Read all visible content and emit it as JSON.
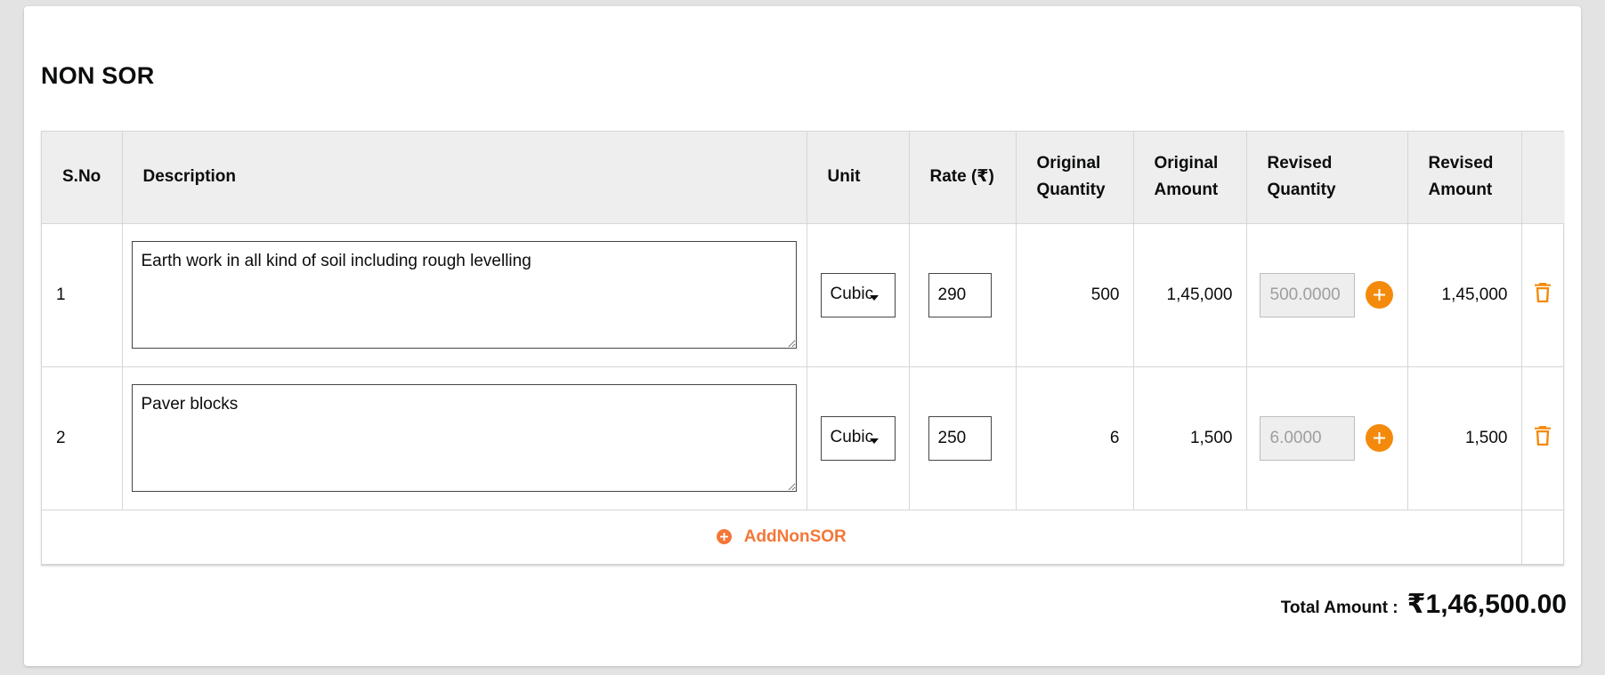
{
  "page": {
    "title": "NON SOR"
  },
  "table": {
    "headers": {
      "sno": "S.No",
      "description": "Description",
      "unit": "Unit",
      "rate": "Rate (₹)",
      "original_quantity_1": "Original",
      "original_quantity_2": "Quantity",
      "original_amount_1": "Original",
      "original_amount_2": "Amount",
      "revised_quantity_1": "Revised",
      "revised_quantity_2": "Quantity",
      "revised_amount_1": "Revised",
      "revised_amount_2": "Amount"
    },
    "rows": [
      {
        "sno": "1",
        "description": "Earth work in all kind of soil including rough levelling",
        "unit": "Cubic",
        "rate": "290",
        "original_quantity": "500",
        "original_amount": "1,45,000",
        "revised_quantity": "500.0000",
        "revised_amount": "1,45,000"
      },
      {
        "sno": "2",
        "description": "Paver blocks",
        "unit": "Cubic",
        "rate": "250",
        "original_quantity": "6",
        "original_amount": "1,500",
        "revised_quantity": "6.0000",
        "revised_amount": "1,500"
      }
    ],
    "add_label": "AddNonSOR"
  },
  "total": {
    "label": "Total Amount :",
    "value": "₹1,46,500.00"
  },
  "icons": {
    "delete": "trash-icon",
    "add_quantity": "plus-circle-icon",
    "add_row": "plus-circle-icon"
  },
  "colors": {
    "accent": "#f48a0c",
    "link": "#f47738",
    "header_bg": "#eeeeee"
  }
}
